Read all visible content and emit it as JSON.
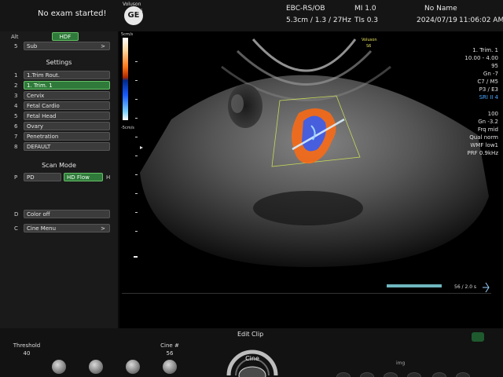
{
  "header": {
    "exam_status": "No exam started!",
    "brand": "Voluson",
    "probe": "S6",
    "preset": "EBC-RS/OB",
    "mi": "MI 1.0",
    "patient": "No Name",
    "depth_info": "5.3cm / 1.3 / 27Hz",
    "tis": "TIs 0.3",
    "date": "2024/07/19",
    "time": "11:06:02 AM"
  },
  "left_panel": {
    "alt_label": "Alt",
    "hdf_button": "HDF",
    "sub_key": "5",
    "sub_button": "Sub",
    "sub_arrow": ">",
    "settings_title": "Settings",
    "settings": [
      {
        "num": "1",
        "label": "1.Trim Rout."
      },
      {
        "num": "2",
        "label": "1. Trim. 1"
      },
      {
        "num": "3",
        "label": "Cervix"
      },
      {
        "num": "4",
        "label": "Fetal Cardio"
      },
      {
        "num": "5",
        "label": "Fetal Head"
      },
      {
        "num": "6",
        "label": "Ovary"
      },
      {
        "num": "7",
        "label": "Penetration"
      },
      {
        "num": "8",
        "label": "DEFAULT"
      }
    ],
    "scan_mode_title": "Scan Mode",
    "p_key": "P",
    "pd_button": "PD",
    "hdflow_button": "HD Flow",
    "h_key": "H",
    "d_key": "D",
    "color_off_button": "Color off",
    "c_key": "C",
    "cine_menu_button": "Cine Menu",
    "cine_menu_arrow": ">"
  },
  "colorbar": {
    "top_label": "5cm/s",
    "bottom_label": "-5cm/s"
  },
  "image_overlay": {
    "brand": "Voluson",
    "probe": "S6"
  },
  "right_params": {
    "lines1": [
      "1. Trim. 1",
      "10.00 - 4.00",
      "95",
      "Gn -7",
      "C7 / M5",
      "P3 / E3",
      "SRI II 4"
    ],
    "lines2": [
      "100",
      "Gn -3.2",
      "Frq mid",
      "Qual norm",
      "WMF low1",
      "PRF 0.9kHz"
    ]
  },
  "cine": {
    "frame_readout": "56 / 2.0 s"
  },
  "bottom": {
    "threshold_label": "Threshold",
    "threshold_value": "40",
    "cine_label": "Cine #",
    "cine_value": "56",
    "edit_clip": "Edit Clip",
    "cine_button": "Cine",
    "img_label": "img"
  },
  "colors": {
    "accent_green": "#2f7a3a",
    "highlight_blue": "#4aa8ff"
  }
}
